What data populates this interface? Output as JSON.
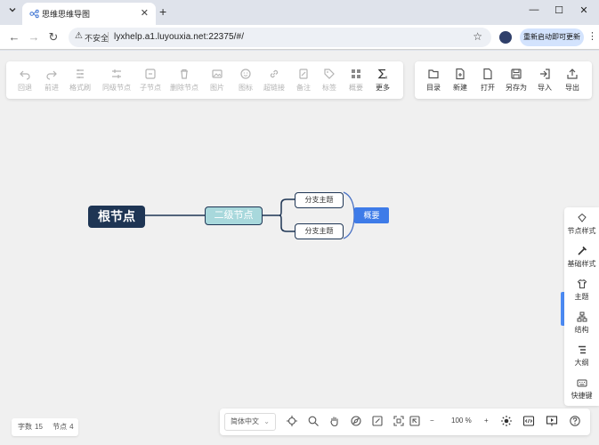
{
  "browser": {
    "tab_title": "思维思维导图",
    "tab_menu_icon": "chevron-down-icon",
    "new_tab_label": "+",
    "close_tab_label": "✕",
    "window": {
      "minimize": "—",
      "maximize": "☐",
      "close": "✕"
    },
    "nav": {
      "back": "←",
      "forward": "→",
      "reload": "↻"
    },
    "security_label": "不安全",
    "url": "lyxhelp.a1.luyouxia.net:22375/#/",
    "update_button": "重新启动即可更新",
    "menu_icon": "⋮"
  },
  "toolbar_left": [
    {
      "label": "回退",
      "icon": "undo-icon",
      "enabled": false
    },
    {
      "label": "前进",
      "icon": "redo-icon",
      "enabled": false
    },
    {
      "label": "格式刷",
      "icon": "format-painter-icon",
      "enabled": false
    },
    {
      "label": "同级节点",
      "icon": "sibling-node-icon",
      "enabled": false
    },
    {
      "label": "子节点",
      "icon": "child-node-icon",
      "enabled": false
    },
    {
      "label": "删除节点",
      "icon": "delete-node-icon",
      "enabled": false
    },
    {
      "label": "图片",
      "icon": "image-icon",
      "enabled": false
    },
    {
      "label": "图标",
      "icon": "emoji-icon",
      "enabled": false
    },
    {
      "label": "超链接",
      "icon": "link-icon",
      "enabled": false
    },
    {
      "label": "备注",
      "icon": "note-icon",
      "enabled": false
    },
    {
      "label": "标签",
      "icon": "tag-icon",
      "enabled": false
    },
    {
      "label": "概要",
      "icon": "summary-icon",
      "enabled": false
    },
    {
      "label": "更多",
      "icon": "formula-icon",
      "enabled": true
    }
  ],
  "toolbar_right": [
    {
      "label": "目录",
      "icon": "folder-icon"
    },
    {
      "label": "新建",
      "icon": "new-file-icon"
    },
    {
      "label": "打开",
      "icon": "open-file-icon"
    },
    {
      "label": "另存为",
      "icon": "save-as-icon"
    },
    {
      "label": "导入",
      "icon": "import-icon"
    },
    {
      "label": "导出",
      "icon": "export-icon"
    }
  ],
  "mindmap": {
    "root": "根节点",
    "level2": "二级节点",
    "topics": [
      "分支主题",
      "分支主题"
    ],
    "summary": "概要",
    "colors": {
      "root": "#1e3554",
      "level2": "#a8d8dc",
      "summary": "#3e7be8",
      "line": "#1e3554"
    }
  },
  "sidebar": [
    {
      "label": "节点样式",
      "icon": "node-style-icon"
    },
    {
      "label": "基础样式",
      "icon": "base-style-icon"
    },
    {
      "label": "主题",
      "icon": "theme-icon"
    },
    {
      "label": "结构",
      "icon": "structure-icon"
    },
    {
      "label": "大纲",
      "icon": "outline-icon"
    },
    {
      "label": "快捷键",
      "icon": "keyboard-icon"
    }
  ],
  "stats": {
    "words_label": "字数",
    "words": "15",
    "nodes_label": "节点",
    "nodes": "4"
  },
  "bottom": {
    "language": "简体中文",
    "zoom_minus": "−",
    "zoom": "100",
    "zoom_unit": "%",
    "zoom_plus": "+"
  }
}
